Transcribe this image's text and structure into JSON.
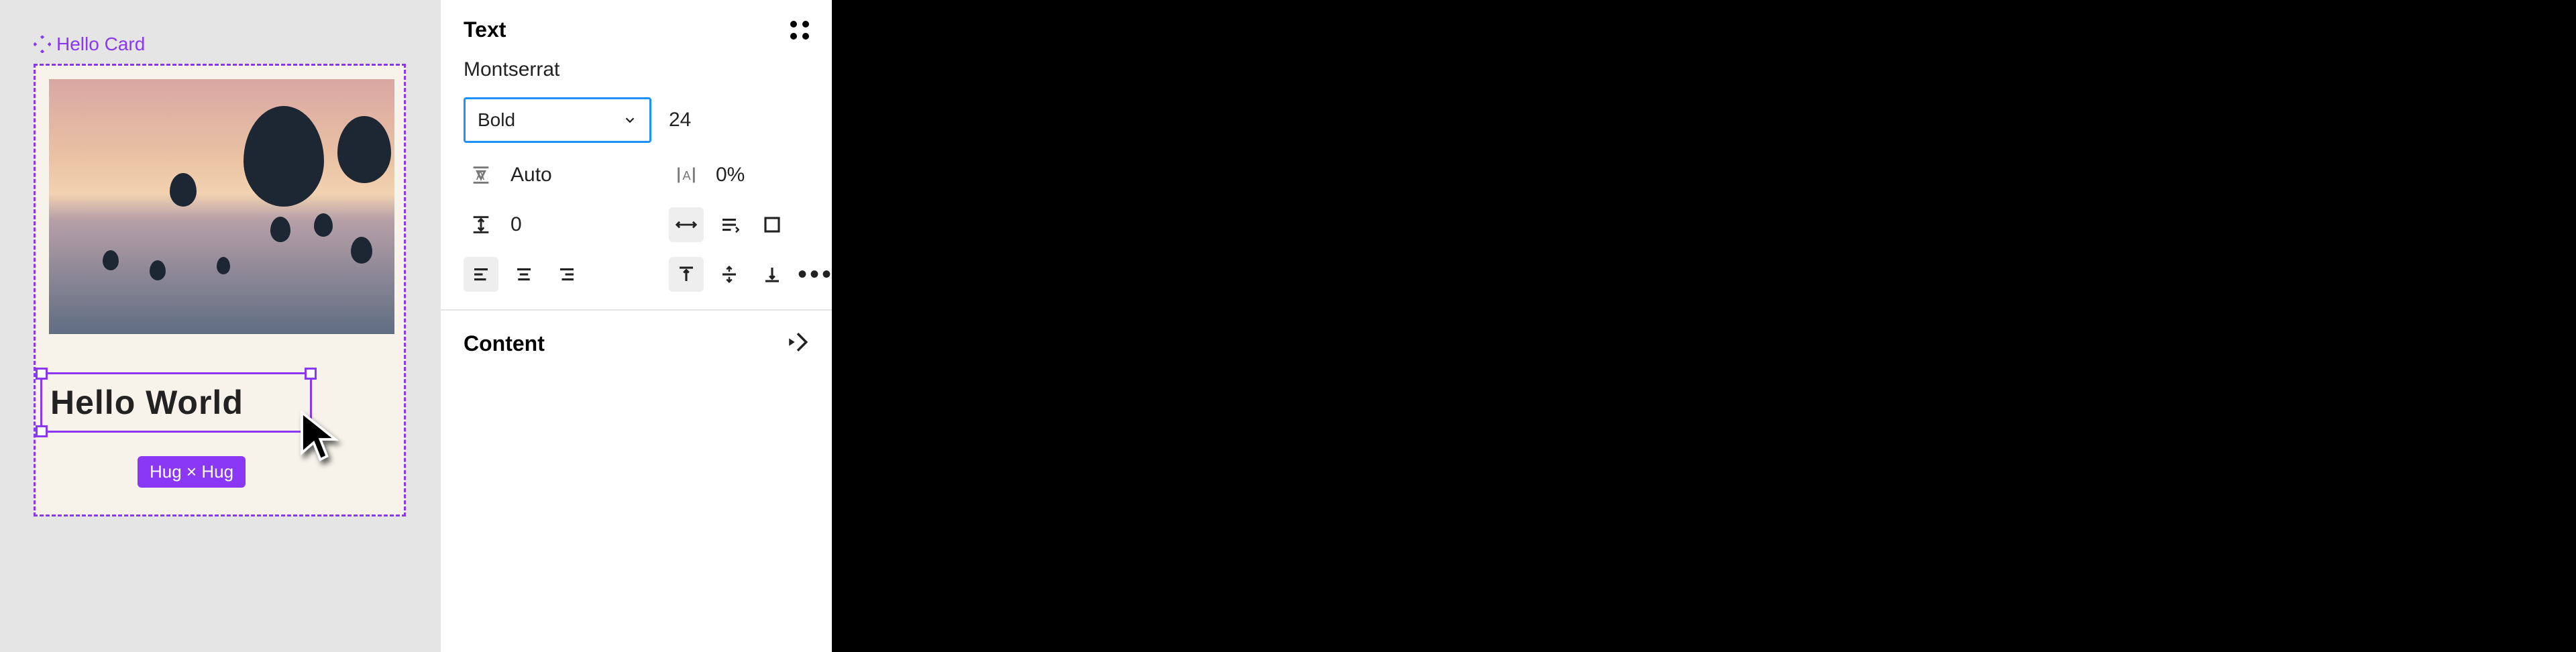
{
  "canvas": {
    "component_name": "Hello Card",
    "text_layer": {
      "value": "Hello World"
    },
    "size_badge": "Hug × Hug"
  },
  "panel": {
    "text_section": {
      "title": "Text",
      "font_family": "Montserrat",
      "font_weight_selected": "Bold",
      "font_size": "24",
      "line_height": {
        "icon": "line-height-icon",
        "value": "Auto"
      },
      "letter_spacing": {
        "icon": "letter-spacing-icon",
        "value": "0%"
      },
      "paragraph_spacing": {
        "icon": "paragraph-spacing-icon",
        "value": "0"
      },
      "resize_modes": [
        "auto-width",
        "auto-height",
        "fixed"
      ],
      "h_align": [
        "left",
        "center",
        "right"
      ],
      "v_align": [
        "top",
        "middle",
        "bottom"
      ],
      "more": "•••"
    },
    "content_section": {
      "title": "Content"
    }
  }
}
